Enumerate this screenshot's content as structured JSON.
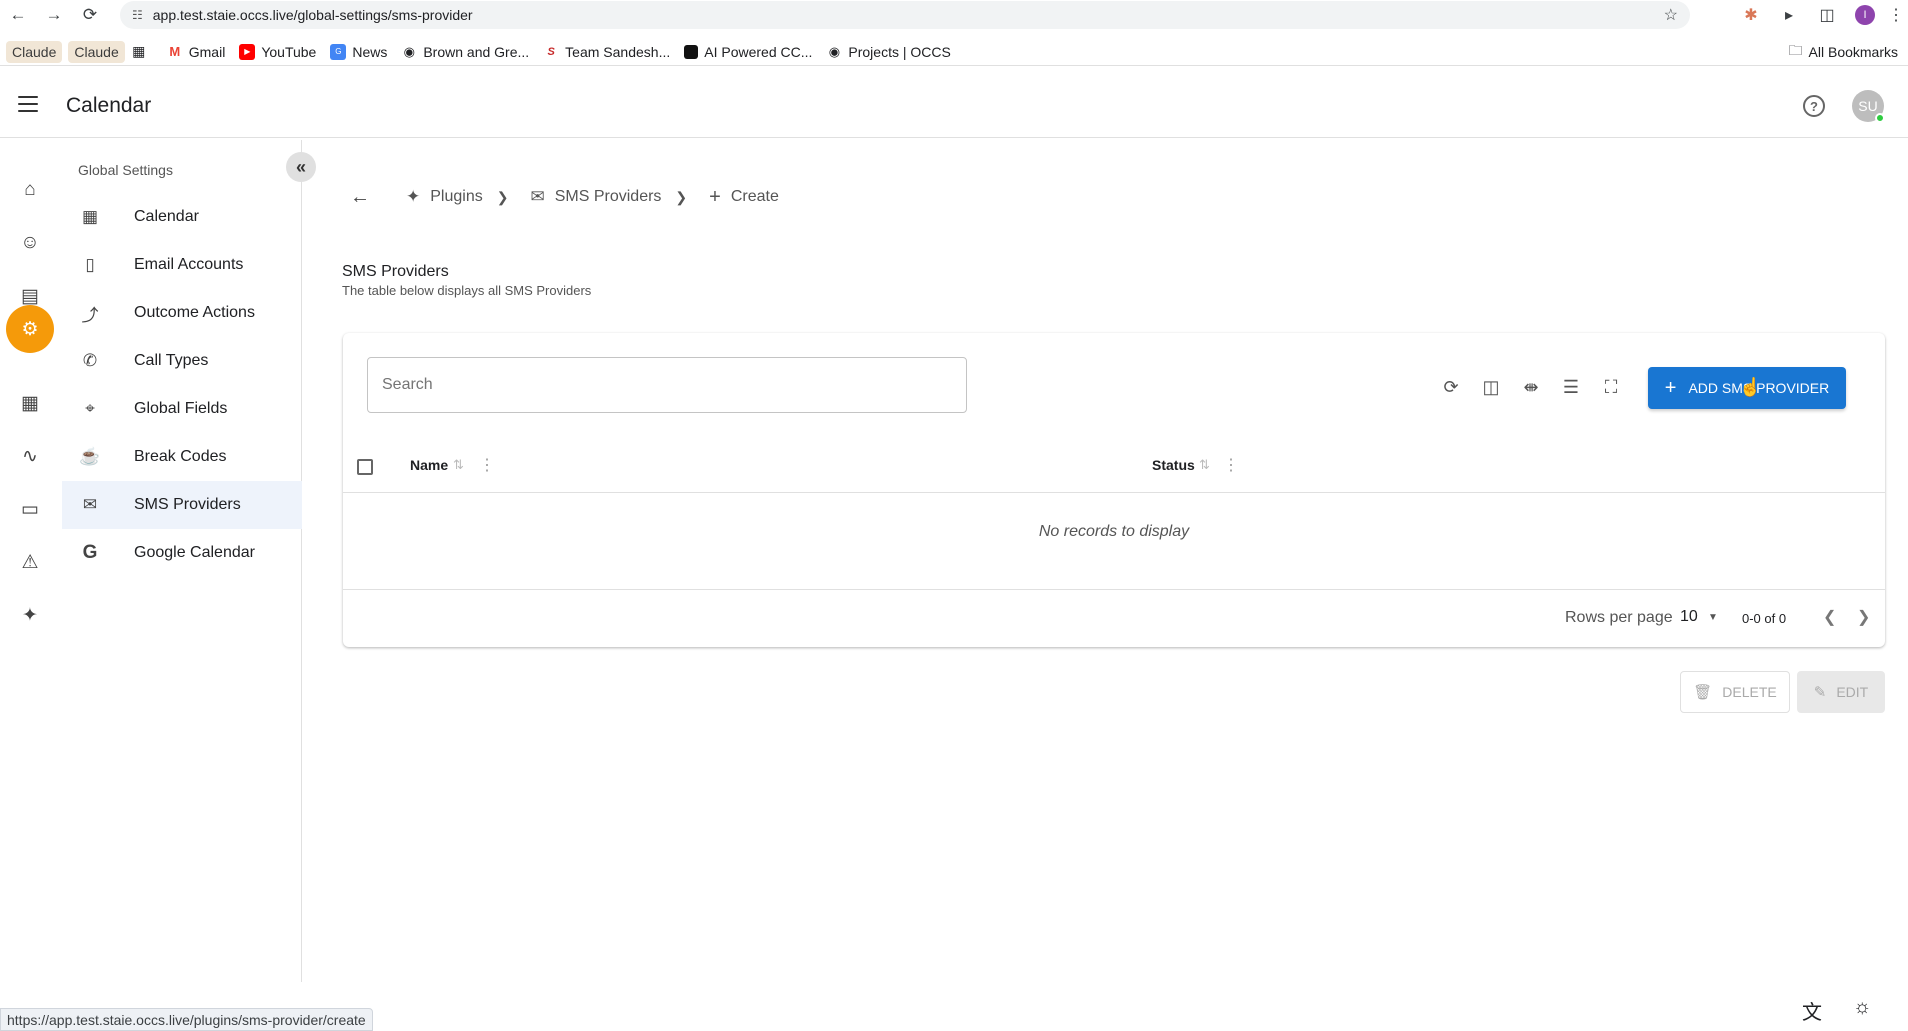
{
  "browser": {
    "url": "app.test.staie.occs.live/global-settings/sms-provider",
    "status_url": "https://app.test.staie.occs.live/plugins/sms-provider/create",
    "profile_initial": "I"
  },
  "bookmarks": [
    {
      "label": "Claude",
      "icon": "none"
    },
    {
      "label": "Claude",
      "icon": "none"
    },
    {
      "label": "",
      "icon": "apps-grid-icon"
    },
    {
      "label": "Gmail",
      "icon": "gmail-icon"
    },
    {
      "label": "YouTube",
      "icon": "youtube-icon"
    },
    {
      "label": "News",
      "icon": "news-icon"
    },
    {
      "label": "Brown and Gre...",
      "icon": "globe-icon"
    },
    {
      "label": "Team Sandesh...",
      "icon": "team-icon"
    },
    {
      "label": "AI Powered CC...",
      "icon": "dark-square-icon"
    },
    {
      "label": "Projects | OCCS",
      "icon": "globe-icon"
    }
  ],
  "bookmarks_right": "All Bookmarks",
  "header": {
    "title": "Calendar",
    "avatar": "SU"
  },
  "sidebar": {
    "title": "Global Settings",
    "items": [
      {
        "label": "Calendar",
        "icon": "calendar-icon"
      },
      {
        "label": "Email Accounts",
        "icon": "email-accounts-icon"
      },
      {
        "label": "Outcome Actions",
        "icon": "outcome-actions-icon"
      },
      {
        "label": "Call Types",
        "icon": "phone-icon"
      },
      {
        "label": "Global Fields",
        "icon": "global-fields-icon"
      },
      {
        "label": "Break Codes",
        "icon": "coffee-icon"
      },
      {
        "label": "SMS Providers",
        "icon": "sms-icon"
      },
      {
        "label": "Google Calendar",
        "icon": "google-icon"
      }
    ],
    "active_index": 6
  },
  "breadcrumb": {
    "items": [
      "Plugins",
      "SMS Providers",
      "Create"
    ]
  },
  "page": {
    "title": "SMS Providers",
    "subtitle": "The table below displays all SMS Providers"
  },
  "table": {
    "search_placeholder": "Search",
    "add_button": "ADD SMS PROVIDER",
    "columns": [
      "Name",
      "Status"
    ],
    "empty_message": "No records to display",
    "rows_per_page_label": "Rows per page",
    "rows_per_page": "10",
    "range": "0-0 of 0"
  },
  "actions": {
    "delete": "DELETE",
    "edit": "EDIT"
  },
  "colors": {
    "accent": "#1976d2",
    "rail_active": "#f59a0a"
  }
}
